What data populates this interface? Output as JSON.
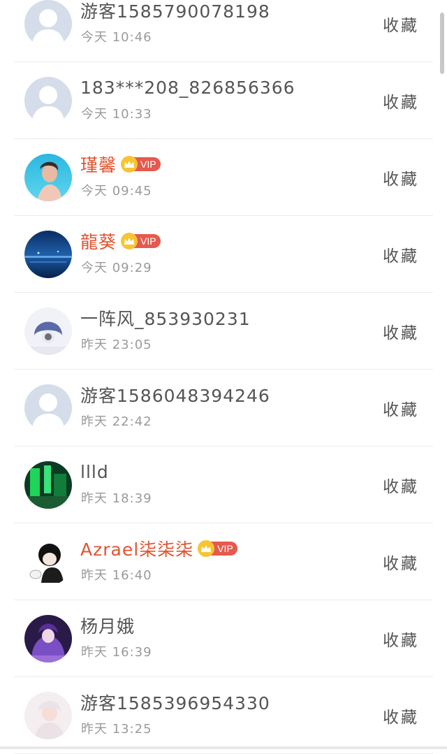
{
  "favorite_label": "收藏",
  "vip_label": "VIP",
  "colors": {
    "vip_name": "#e2532f",
    "vip_badge": "#e45a4e",
    "crown": "#f7c533"
  },
  "users": [
    {
      "name": "游客1585790078198",
      "time": "今天 10:46",
      "vip": false,
      "avatar": "default-avatar"
    },
    {
      "name": "183***208_826856366",
      "time": "今天 10:33",
      "vip": false,
      "avatar": "default-avatar"
    },
    {
      "name": "瑾馨",
      "time": "今天 09:45",
      "vip": true,
      "avatar": "girl-underwater-photo"
    },
    {
      "name": "龍葵",
      "time": "今天 09:29",
      "vip": true,
      "avatar": "night-sea-photo"
    },
    {
      "name": "一阵风_853930231",
      "time": "昨天 23:05",
      "vip": false,
      "avatar": "anime-girl-photo"
    },
    {
      "name": "游客1586048394246",
      "time": "昨天 22:42",
      "vip": false,
      "avatar": "default-avatar"
    },
    {
      "name": "llld",
      "time": "昨天 18:39",
      "vip": false,
      "avatar": "green-abstract-photo"
    },
    {
      "name": "Azrael柒柒柒",
      "time": "昨天 16:40",
      "vip": true,
      "avatar": "cartoon-boy-avatar"
    },
    {
      "name": "杨月娥",
      "time": "昨天 16:39",
      "vip": false,
      "avatar": "purple-anime-photo"
    },
    {
      "name": "游客1585396954330",
      "time": "昨天 13:25",
      "vip": false,
      "avatar": "pastel-girl-photo"
    }
  ]
}
